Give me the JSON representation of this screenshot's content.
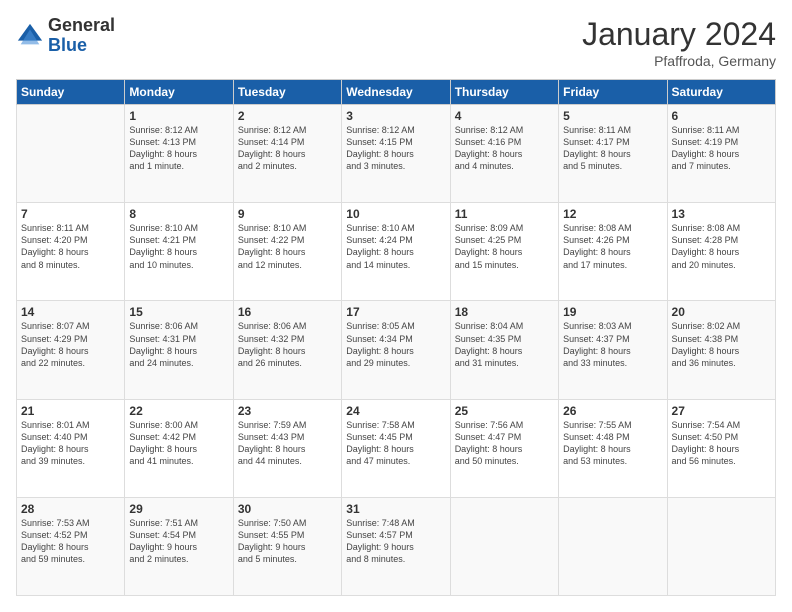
{
  "logo": {
    "general": "General",
    "blue": "Blue"
  },
  "title": "January 2024",
  "location": "Pfaffroda, Germany",
  "header_days": [
    "Sunday",
    "Monday",
    "Tuesday",
    "Wednesday",
    "Thursday",
    "Friday",
    "Saturday"
  ],
  "weeks": [
    [
      {
        "day": "",
        "info": ""
      },
      {
        "day": "1",
        "info": "Sunrise: 8:12 AM\nSunset: 4:13 PM\nDaylight: 8 hours\nand 1 minute."
      },
      {
        "day": "2",
        "info": "Sunrise: 8:12 AM\nSunset: 4:14 PM\nDaylight: 8 hours\nand 2 minutes."
      },
      {
        "day": "3",
        "info": "Sunrise: 8:12 AM\nSunset: 4:15 PM\nDaylight: 8 hours\nand 3 minutes."
      },
      {
        "day": "4",
        "info": "Sunrise: 8:12 AM\nSunset: 4:16 PM\nDaylight: 8 hours\nand 4 minutes."
      },
      {
        "day": "5",
        "info": "Sunrise: 8:11 AM\nSunset: 4:17 PM\nDaylight: 8 hours\nand 5 minutes."
      },
      {
        "day": "6",
        "info": "Sunrise: 8:11 AM\nSunset: 4:19 PM\nDaylight: 8 hours\nand 7 minutes."
      }
    ],
    [
      {
        "day": "7",
        "info": "Sunrise: 8:11 AM\nSunset: 4:20 PM\nDaylight: 8 hours\nand 8 minutes."
      },
      {
        "day": "8",
        "info": "Sunrise: 8:10 AM\nSunset: 4:21 PM\nDaylight: 8 hours\nand 10 minutes."
      },
      {
        "day": "9",
        "info": "Sunrise: 8:10 AM\nSunset: 4:22 PM\nDaylight: 8 hours\nand 12 minutes."
      },
      {
        "day": "10",
        "info": "Sunrise: 8:10 AM\nSunset: 4:24 PM\nDaylight: 8 hours\nand 14 minutes."
      },
      {
        "day": "11",
        "info": "Sunrise: 8:09 AM\nSunset: 4:25 PM\nDaylight: 8 hours\nand 15 minutes."
      },
      {
        "day": "12",
        "info": "Sunrise: 8:08 AM\nSunset: 4:26 PM\nDaylight: 8 hours\nand 17 minutes."
      },
      {
        "day": "13",
        "info": "Sunrise: 8:08 AM\nSunset: 4:28 PM\nDaylight: 8 hours\nand 20 minutes."
      }
    ],
    [
      {
        "day": "14",
        "info": "Sunrise: 8:07 AM\nSunset: 4:29 PM\nDaylight: 8 hours\nand 22 minutes."
      },
      {
        "day": "15",
        "info": "Sunrise: 8:06 AM\nSunset: 4:31 PM\nDaylight: 8 hours\nand 24 minutes."
      },
      {
        "day": "16",
        "info": "Sunrise: 8:06 AM\nSunset: 4:32 PM\nDaylight: 8 hours\nand 26 minutes."
      },
      {
        "day": "17",
        "info": "Sunrise: 8:05 AM\nSunset: 4:34 PM\nDaylight: 8 hours\nand 29 minutes."
      },
      {
        "day": "18",
        "info": "Sunrise: 8:04 AM\nSunset: 4:35 PM\nDaylight: 8 hours\nand 31 minutes."
      },
      {
        "day": "19",
        "info": "Sunrise: 8:03 AM\nSunset: 4:37 PM\nDaylight: 8 hours\nand 33 minutes."
      },
      {
        "day": "20",
        "info": "Sunrise: 8:02 AM\nSunset: 4:38 PM\nDaylight: 8 hours\nand 36 minutes."
      }
    ],
    [
      {
        "day": "21",
        "info": "Sunrise: 8:01 AM\nSunset: 4:40 PM\nDaylight: 8 hours\nand 39 minutes."
      },
      {
        "day": "22",
        "info": "Sunrise: 8:00 AM\nSunset: 4:42 PM\nDaylight: 8 hours\nand 41 minutes."
      },
      {
        "day": "23",
        "info": "Sunrise: 7:59 AM\nSunset: 4:43 PM\nDaylight: 8 hours\nand 44 minutes."
      },
      {
        "day": "24",
        "info": "Sunrise: 7:58 AM\nSunset: 4:45 PM\nDaylight: 8 hours\nand 47 minutes."
      },
      {
        "day": "25",
        "info": "Sunrise: 7:56 AM\nSunset: 4:47 PM\nDaylight: 8 hours\nand 50 minutes."
      },
      {
        "day": "26",
        "info": "Sunrise: 7:55 AM\nSunset: 4:48 PM\nDaylight: 8 hours\nand 53 minutes."
      },
      {
        "day": "27",
        "info": "Sunrise: 7:54 AM\nSunset: 4:50 PM\nDaylight: 8 hours\nand 56 minutes."
      }
    ],
    [
      {
        "day": "28",
        "info": "Sunrise: 7:53 AM\nSunset: 4:52 PM\nDaylight: 8 hours\nand 59 minutes."
      },
      {
        "day": "29",
        "info": "Sunrise: 7:51 AM\nSunset: 4:54 PM\nDaylight: 9 hours\nand 2 minutes."
      },
      {
        "day": "30",
        "info": "Sunrise: 7:50 AM\nSunset: 4:55 PM\nDaylight: 9 hours\nand 5 minutes."
      },
      {
        "day": "31",
        "info": "Sunrise: 7:48 AM\nSunset: 4:57 PM\nDaylight: 9 hours\nand 8 minutes."
      },
      {
        "day": "",
        "info": ""
      },
      {
        "day": "",
        "info": ""
      },
      {
        "day": "",
        "info": ""
      }
    ]
  ]
}
